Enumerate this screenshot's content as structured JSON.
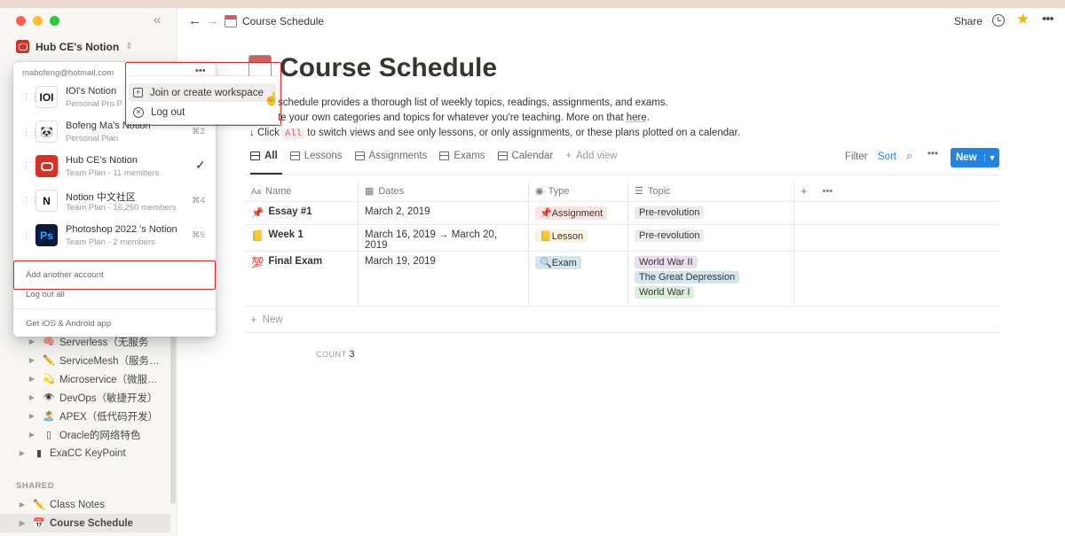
{
  "sidebar": {
    "workspace_name": "Hub CE's Notion",
    "tree": [
      {
        "label": "Serverless（无服务",
        "emoji": "🧠",
        "indent": 1
      },
      {
        "label": "ServiceMesh（服务…",
        "emoji": "✏️",
        "indent": 1
      },
      {
        "label": "Microservice（微服…",
        "emoji": "💫",
        "indent": 1
      },
      {
        "label": "DevOps（敏捷开发）",
        "emoji": "👁️",
        "indent": 1
      },
      {
        "label": "APEX（低代码开发）",
        "emoji": "🏝️",
        "indent": 1
      },
      {
        "label": "Oracle的网络特色",
        "emoji": "▯",
        "indent": 1
      },
      {
        "label": "ExaCC KeyPoint",
        "emoji": "▮",
        "indent": 0
      }
    ],
    "shared_label": "SHARED",
    "shared": [
      {
        "label": "Class Notes",
        "emoji": "✏️"
      },
      {
        "label": "Course Schedule",
        "emoji": "📅"
      }
    ]
  },
  "topbar": {
    "breadcrumb": "Course Schedule",
    "share": "Share"
  },
  "page": {
    "title": "Course Schedule",
    "desc1": "ourse schedule provides a thorough list of weekly topics, readings, assignments, and exams.",
    "desc2_pre": "n create your own categories and topics for whatever you're teaching. More on that ",
    "desc2_link": "here",
    "desc2_post": ".",
    "desc3_pre": "↓ Click ",
    "desc3_code": "All",
    "desc3_post": " to switch views and see only lessons, or only assignments, or these plans plotted on a calendar."
  },
  "views": {
    "tabs": [
      "All",
      "Lessons",
      "Assignments",
      "Exams",
      "Calendar"
    ],
    "add_view": "Add view",
    "filter": "Filter",
    "sort": "Sort",
    "new": "New"
  },
  "table": {
    "headers": [
      "Name",
      "Dates",
      "Type",
      "Topic"
    ],
    "rows": [
      {
        "emoji": "📌",
        "name": "Essay #1",
        "dates": "March 2, 2019",
        "type": {
          "label": "📌Assignment",
          "bg": "#fbe4e4"
        },
        "topics": [
          {
            "label": "Pre-revolution",
            "bg": "#ebeced"
          }
        ]
      },
      {
        "emoji": "📒",
        "name": "Week 1",
        "dates": "March 16, 2019 → March 20, 2019",
        "type": {
          "label": "📒Lesson",
          "bg": "#fbf3db"
        },
        "topics": [
          {
            "label": "Pre-revolution",
            "bg": "#ebeced"
          }
        ]
      },
      {
        "emoji": "💯",
        "name": "Final Exam",
        "dates": "March 19, 2019",
        "type": {
          "label": "🔍Exam",
          "bg": "#d3e5ef"
        },
        "topics": [
          {
            "label": "World War II",
            "bg": "#e8deee"
          },
          {
            "label": "The Great Depression",
            "bg": "#d3e5ef"
          },
          {
            "label": "World War I",
            "bg": "#dbeddb"
          }
        ]
      }
    ],
    "new_label": "New",
    "count_label": "COUNT",
    "count_value": "3"
  },
  "popup": {
    "email": "mabofeng@hotmail.com",
    "workspaces": [
      {
        "name": "IOI's Notion",
        "plan": "Personal Pro P",
        "shortcut": "",
        "logo": "IOI",
        "logo_bg": "#ffffff",
        "logo_color": "#111111"
      },
      {
        "name": "Bofeng Ma's Notion",
        "plan": "Personal Plan",
        "shortcut": "⌘2",
        "logo": "🐼",
        "logo_bg": "#ffffff",
        "logo_color": "#111111"
      },
      {
        "name": "Hub CE's Notion",
        "plan": "Team Plan - 11 members",
        "shortcut": "",
        "logo": "",
        "logo_bg": "#d93025",
        "logo_color": "#ffffff"
      },
      {
        "name": "Notion 中文社区",
        "plan": "Team Plan - 16,250 members",
        "shortcut": "⌘4",
        "logo": "N",
        "logo_bg": "#ffffff",
        "logo_color": "#111111"
      },
      {
        "name": "Photoshop 2022 's Notion",
        "plan": "Team Plan - 2 members",
        "shortcut": "⌘5",
        "logo": "Ps",
        "logo_bg": "#0b1a3c",
        "logo_color": "#31a8ff"
      }
    ],
    "add_account": "Add another account",
    "logout_all": "Log out all",
    "get_app": "Get iOS & Android app"
  },
  "submenu": {
    "join": "Join or create workspace",
    "logout": "Log out"
  }
}
